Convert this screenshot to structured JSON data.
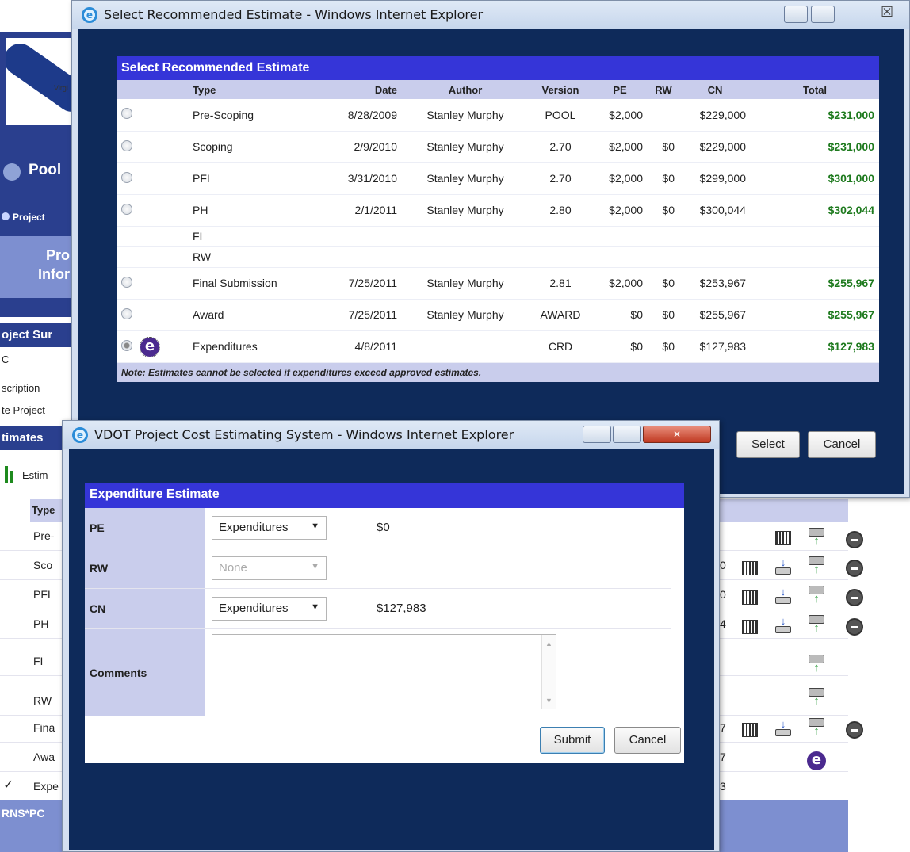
{
  "background_app": {
    "logo_text": "Virgi",
    "pool_label": "Pool",
    "project_button": "Project",
    "pro_info_line1": "Pro",
    "pro_info_line2": "Infor",
    "project_summary": "oject Sur",
    "side_items": [
      "C",
      "scription",
      "te Project"
    ],
    "estimates_section": "timates",
    "estimate_link": "Estim",
    "table_header": "Type",
    "rows": [
      {
        "type": "Pre-",
        "digit": ""
      },
      {
        "type": "Sco",
        "digit": "0"
      },
      {
        "type": "PFI",
        "digit": "0"
      },
      {
        "type": "PH",
        "digit": "4"
      },
      {
        "type": "FI",
        "digit": ""
      },
      {
        "type": "RW",
        "digit": ""
      },
      {
        "type": "Fina",
        "digit": "7"
      },
      {
        "type": "Awa",
        "digit": "7"
      },
      {
        "type": "Expe",
        "digit": "3"
      }
    ],
    "bottom_bar": "RNS*PC"
  },
  "main_window": {
    "title": "Select Recommended Estimate - Windows Internet Explorer",
    "panel_title": "Select Recommended Estimate",
    "columns": [
      "Type",
      "Date",
      "Author",
      "Version",
      "PE",
      "RW",
      "CN",
      "Total"
    ],
    "rows": [
      {
        "selectable": true,
        "type": "Pre-Scoping",
        "date": "8/28/2009",
        "author": "Stanley Murphy",
        "version": "POOL",
        "pe": "$2,000",
        "rw": "",
        "cn": "$229,000",
        "total": "$231,000"
      },
      {
        "selectable": true,
        "type": "Scoping",
        "date": "2/9/2010",
        "author": "Stanley Murphy",
        "version": "2.70",
        "pe": "$2,000",
        "rw": "$0",
        "cn": "$229,000",
        "total": "$231,000"
      },
      {
        "selectable": true,
        "type": "PFI",
        "date": "3/31/2010",
        "author": "Stanley Murphy",
        "version": "2.70",
        "pe": "$2,000",
        "rw": "$0",
        "cn": "$299,000",
        "total": "$301,000"
      },
      {
        "selectable": true,
        "type": "PH",
        "date": "2/1/2011",
        "author": "Stanley Murphy",
        "version": "2.80",
        "pe": "$2,000",
        "rw": "$0",
        "cn": "$300,044",
        "total": "$302,044"
      },
      {
        "selectable": false,
        "type": "FI",
        "date": "",
        "author": "",
        "version": "",
        "pe": "",
        "rw": "",
        "cn": "",
        "total": ""
      },
      {
        "selectable": false,
        "type": "RW",
        "date": "",
        "author": "",
        "version": "",
        "pe": "",
        "rw": "",
        "cn": "",
        "total": ""
      },
      {
        "selectable": true,
        "type": "Final Submission",
        "date": "7/25/2011",
        "author": "Stanley Murphy",
        "version": "2.81",
        "pe": "$2,000",
        "rw": "$0",
        "cn": "$253,967",
        "total": "$255,967"
      },
      {
        "selectable": true,
        "type": "Award",
        "date": "7/25/2011",
        "author": "Stanley Murphy",
        "version": "AWARD",
        "pe": "$0",
        "rw": "$0",
        "cn": "$255,967",
        "total": "$255,967"
      },
      {
        "selectable": true,
        "type": "Expenditures",
        "date": "4/8/2011",
        "author": "",
        "version": "CRD",
        "pe": "$0",
        "rw": "$0",
        "cn": "$127,983",
        "total": "$127,983"
      }
    ],
    "note": "Note: Estimates cannot be selected if expenditures exceed approved estimates.",
    "select_button": "Select",
    "cancel_button": "Cancel"
  },
  "expenditure_window": {
    "title": "VDOT Project Cost Estimating System - Windows Internet Explorer",
    "panel_title": "Expenditure Estimate",
    "pe_label": "PE",
    "pe_select": "Expenditures",
    "pe_value": "$0",
    "rw_label": "RW",
    "rw_select": "None",
    "cn_label": "CN",
    "cn_select": "Expenditures",
    "cn_value": "$127,983",
    "comments_label": "Comments",
    "submit_button": "Submit",
    "cancel_button": "Cancel"
  },
  "colors": {
    "header_blue": "#3535d8",
    "dark_navy": "#0e2a5a",
    "total_green": "#1e7a1e",
    "lavender": "#c9cdec"
  }
}
